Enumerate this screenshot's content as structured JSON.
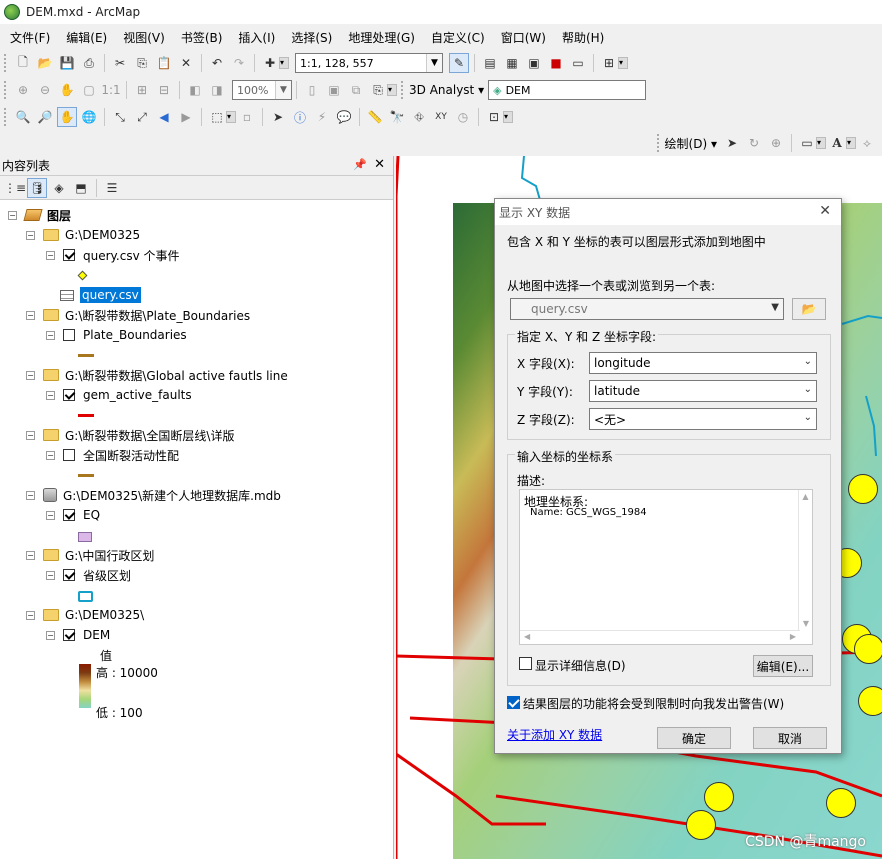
{
  "window": {
    "title": "DEM.mxd - ArcMap"
  },
  "menu": [
    "文件(F)",
    "编辑(E)",
    "视图(V)",
    "书签(B)",
    "插入(I)",
    "选择(S)",
    "地理处理(G)",
    "自定义(C)",
    "窗口(W)",
    "帮助(H)"
  ],
  "toolbar": {
    "scale": "1:1, 128, 557",
    "zoom_percent": "100%",
    "analyst_label": "3D Analyst",
    "analyst_layer": "DEM",
    "draw_label": "绘制(D)"
  },
  "toc": {
    "title": "内容列表",
    "root": "图层",
    "items": [
      {
        "label": "G:\\DEM0325",
        "kind": "folder"
      },
      {
        "label": "query.csv 个事件",
        "kind": "layer",
        "checked": true
      },
      {
        "label": "query.csv",
        "kind": "table",
        "selected": true
      },
      {
        "label": "G:\\断裂带数据\\Plate_Boundaries",
        "kind": "folder"
      },
      {
        "label": "Plate_Boundaries",
        "kind": "layer",
        "checked": false
      },
      {
        "label": "G:\\断裂带数据\\Global active fautls line",
        "kind": "folder"
      },
      {
        "label": "gem_active_faults",
        "kind": "layer",
        "checked": true
      },
      {
        "label": "G:\\断裂带数据\\全国断层线\\详版",
        "kind": "folder"
      },
      {
        "label": "全国断裂活动性配",
        "kind": "layer",
        "checked": false
      },
      {
        "label": "G:\\DEM0325\\新建个人地理数据库.mdb",
        "kind": "database"
      },
      {
        "label": "EQ",
        "kind": "layer",
        "checked": true
      },
      {
        "label": "G:\\中国行政区划",
        "kind": "folder"
      },
      {
        "label": "省级区划",
        "kind": "layer",
        "checked": true
      },
      {
        "label": "G:\\DEM0325\\",
        "kind": "folder"
      },
      {
        "label": "DEM",
        "kind": "layer",
        "checked": true
      }
    ],
    "dem_legend": {
      "title": "值",
      "high": "高 : 10000",
      "low": "低 : 100"
    }
  },
  "dialog": {
    "title": "显示 XY 数据",
    "intro": "包含 X 和 Y 坐标的表可以图层形式添加到地图中",
    "choose_label": "从地图中选择一个表或浏览到另一个表:",
    "table_value": "query.csv",
    "fields_group": "指定 X、Y 和 Z 坐标字段:",
    "x_label": "X 字段(X):",
    "x_value": "longitude",
    "y_label": "Y 字段(Y):",
    "y_value": "latitude",
    "z_label": "Z 字段(Z):",
    "z_value": "<无>",
    "coord_group": "输入坐标的坐标系",
    "desc_label": "描述:",
    "desc_line1": "地理坐标系:",
    "desc_line2": "Name: GCS_WGS_1984",
    "show_details": "显示详细信息(D)",
    "edit_button": "编辑(E)...",
    "warn_label": "结果图层的功能将会受到限制时向我发出警告(W)",
    "about_link": "关于添加 XY 数据",
    "ok": "确定",
    "cancel": "取消"
  },
  "watermark": "CSDN @青mango",
  "colors": {
    "selection": "#0078d7",
    "fault_red": "#e00000",
    "event_yellow": "#ffff00"
  }
}
